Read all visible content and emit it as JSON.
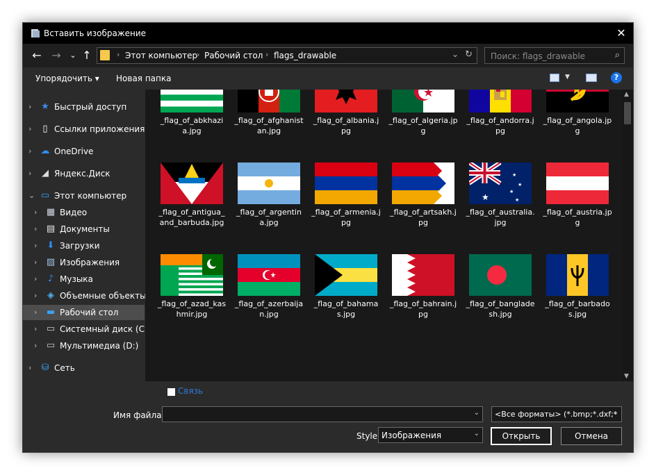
{
  "window": {
    "title": "Вставить изображение"
  },
  "nav": {
    "back": "←",
    "forward": "→",
    "recent": "⌄",
    "up": "↑",
    "crumb_sep": "›",
    "breadcrumbs": [
      "Этот компьютер",
      "Рабочий стол",
      "flags_drawable"
    ],
    "search_placeholder": "Поиск: flags_drawable"
  },
  "toolbar": {
    "organize": "Упорядочить ▾",
    "new_folder": "Новая папка",
    "help": "?"
  },
  "sidebar": {
    "items": [
      {
        "label": "Быстрый доступ",
        "icon": "star-icon",
        "chevron": "›"
      },
      {
        "label": "Ссылки приложения",
        "icon": "document-icon",
        "chevron": "›"
      },
      {
        "label": "OneDrive",
        "icon": "cloud-icon",
        "chevron": "›"
      },
      {
        "label": "Яндекс.Диск",
        "icon": "yandex-disk-icon",
        "chevron": "›"
      },
      {
        "label": "Этот компьютер",
        "icon": "computer-icon",
        "chevron": "⌄"
      },
      {
        "label": "Видео",
        "icon": "video-icon",
        "chevron": "›"
      },
      {
        "label": "Документы",
        "icon": "documents-icon",
        "chevron": "›"
      },
      {
        "label": "Загрузки",
        "icon": "download-icon",
        "chevron": "›"
      },
      {
        "label": "Изображения",
        "icon": "pictures-icon",
        "chevron": "›"
      },
      {
        "label": "Музыка",
        "icon": "music-icon",
        "chevron": "›"
      },
      {
        "label": "Объемные объекты",
        "icon": "3d-objects-icon",
        "chevron": "›"
      },
      {
        "label": "Рабочий стол",
        "icon": "desktop-icon",
        "chevron": "›",
        "selected": true
      },
      {
        "label": "Системный диск (C:)",
        "icon": "drive-icon",
        "chevron": "›"
      },
      {
        "label": "Мультимедиа (D:)",
        "icon": "drive-icon",
        "chevron": "›"
      },
      {
        "label": "Сеть",
        "icon": "network-icon",
        "chevron": "›"
      }
    ]
  },
  "files": [
    {
      "name": "_flag_of_abkhazia.jpg",
      "flag": "abkhazia"
    },
    {
      "name": "_flag_of_afghanistan.jpg",
      "flag": "afghanistan"
    },
    {
      "name": "_flag_of_albania.jpg",
      "flag": "albania"
    },
    {
      "name": "_flag_of_algeria.jpg",
      "flag": "algeria"
    },
    {
      "name": "_flag_of_andorra.jpg",
      "flag": "andorra"
    },
    {
      "name": "_flag_of_angola.jpg",
      "flag": "angola"
    },
    {
      "name": "_flag_of_antigua_and_barbuda.jpg",
      "flag": "antigua"
    },
    {
      "name": "_flag_of_argentina.jpg",
      "flag": "argentina"
    },
    {
      "name": "_flag_of_armenia.jpg",
      "flag": "armenia"
    },
    {
      "name": "_flag_of_artsakh.jpg",
      "flag": "artsakh"
    },
    {
      "name": "_flag_of_australia.jpg",
      "flag": "australia"
    },
    {
      "name": "_flag_of_austria.jpg",
      "flag": "austria"
    },
    {
      "name": "_flag_of_azad_kashmir.jpg",
      "flag": "azad_kashmir"
    },
    {
      "name": "_flag_of_azerbaijan.jpg",
      "flag": "azerbaijan"
    },
    {
      "name": "_flag_of_bahamas.jpg",
      "flag": "bahamas"
    },
    {
      "name": "_flag_of_bahrain.jpg",
      "flag": "bahrain"
    },
    {
      "name": "_flag_of_bangladesh.jpg",
      "flag": "bangladesh"
    },
    {
      "name": "_flag_of_barbados.jpg",
      "flag": "barbados"
    }
  ],
  "bottom": {
    "link_label": "Связь",
    "filename_label": "Имя файла:",
    "filename_value": "",
    "format_value": "<Все форматы> (*.bmp;*.dxf;*",
    "style_label": "Style",
    "style_value": "Изображения",
    "open_label": "Открыть",
    "cancel_label": "Отмена"
  },
  "colors": {
    "accent_link": "#2e79d3",
    "background": "#2b2b2b",
    "content": "#191919",
    "selection": "#4d4d4d"
  }
}
